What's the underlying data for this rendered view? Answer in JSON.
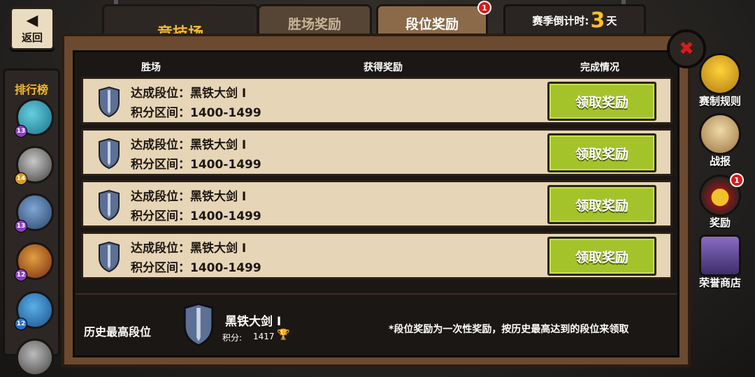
{
  "back": {
    "label": "返回"
  },
  "tabs": {
    "arena": "竞技场",
    "win_reward": "胜场奖励",
    "rank_reward": "段位奖励",
    "rank_badge": "1"
  },
  "season": {
    "prefix": "赛季倒计时:",
    "value": "3",
    "unit": "天"
  },
  "leaderboard": {
    "title": "排行榜",
    "levels": [
      "13",
      "14",
      "13",
      "12",
      "12"
    ]
  },
  "table": {
    "headers": {
      "win": "胜场",
      "reward": "获得奖励",
      "status": "完成情况"
    },
    "rows": [
      {
        "rank": "达成段位：黑铁大剑 I",
        "range": "积分区间：1400-1499",
        "button": "领取奖励"
      },
      {
        "rank": "达成段位：黑铁大剑 I",
        "range": "积分区间：1400-1499",
        "button": "领取奖励"
      },
      {
        "rank": "达成段位：黑铁大剑 I",
        "range": "积分区间：1400-1499",
        "button": "领取奖励"
      },
      {
        "rank": "达成段位：黑铁大剑 I",
        "range": "积分区间：1400-1499",
        "button": "领取奖励"
      }
    ]
  },
  "history": {
    "label": "历史最高段位",
    "rank_name": "黑铁大剑 I",
    "score_label": "积分:",
    "score_value": "1417",
    "note": "*段位奖励为一次性奖励，按历史最高达到的段位来领取"
  },
  "side_menu": {
    "rules": "赛制规则",
    "battle_report": "战报",
    "reward": "奖励",
    "reward_badge": "1",
    "honor_shop": "荣誉商店"
  },
  "colors": {
    "accent_gold": "#f7b92b",
    "claim_green": "#a4c32b",
    "row_parchment": "#e6d5b6",
    "badge_red": "#d81a1a"
  }
}
